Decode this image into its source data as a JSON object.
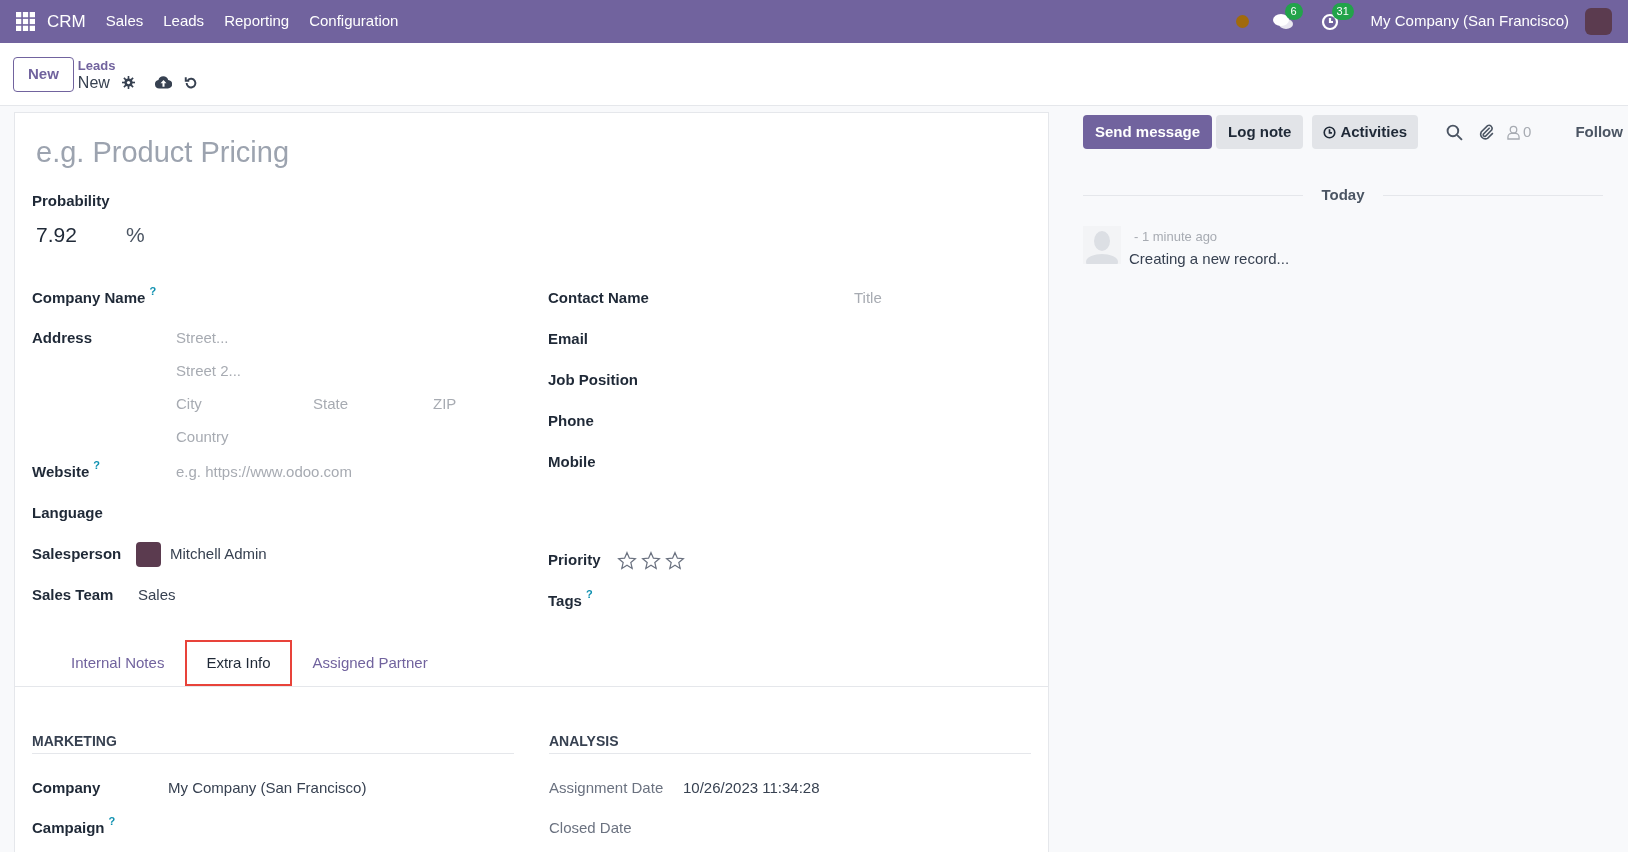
{
  "navbar": {
    "app": "CRM",
    "menu": [
      "Sales",
      "Leads",
      "Reporting",
      "Configuration"
    ],
    "messages_badge": "6",
    "activities_badge": "31",
    "company": "My Company (San Francisco)"
  },
  "control_panel": {
    "new_button": "New",
    "breadcrumb": "Leads",
    "record": "New"
  },
  "form": {
    "title_placeholder": "e.g. Product Pricing",
    "probability": {
      "label": "Probability",
      "value": "7.92",
      "unit": "%"
    },
    "left_fields": [
      {
        "kind": "plain",
        "label": "Company Name",
        "help": "?"
      },
      {
        "kind": "address",
        "label": "Address",
        "street": "Street...",
        "street2": "Street 2...",
        "city": "City",
        "state": "State",
        "zip": "ZIP",
        "country": "Country"
      },
      {
        "kind": "plain",
        "label": "Website",
        "help": "?",
        "placeholder": "e.g. https://www.odoo.com"
      },
      {
        "kind": "plain",
        "label": "Language"
      },
      {
        "kind": "user",
        "label": "Salesperson",
        "value": "Mitchell Admin"
      },
      {
        "kind": "plain",
        "label": "Sales Team",
        "value": "Sales"
      }
    ],
    "right_fields": [
      {
        "kind": "plain",
        "label": "Contact Name",
        "placeholder": "Title"
      },
      {
        "kind": "plain",
        "label": "Email"
      },
      {
        "kind": "plain",
        "label": "Job Position"
      },
      {
        "kind": "plain",
        "label": "Phone"
      },
      {
        "kind": "plain",
        "label": "Mobile"
      },
      {
        "kind": "stars",
        "label": "Priority",
        "stars": 0
      },
      {
        "kind": "plain",
        "label": "Tags",
        "help": "?"
      }
    ],
    "tabs": [
      {
        "label": "Internal Notes",
        "selected": false,
        "highlighted": false
      },
      {
        "label": "Extra Info",
        "selected": true,
        "highlighted": true
      },
      {
        "label": "Assigned Partner",
        "selected": false,
        "highlighted": false
      }
    ],
    "sections": [
      {
        "heading": "MARKETING",
        "fields": [
          {
            "label": "Company",
            "value": "My Company (San Francisco)",
            "muted": false
          },
          {
            "label": "Campaign",
            "help": "?",
            "muted": false
          }
        ]
      },
      {
        "heading": "ANALYSIS",
        "fields": [
          {
            "label": "Assignment Date",
            "value": "10/26/2023 11:34:28",
            "muted": true
          },
          {
            "label": "Closed Date",
            "muted": true
          }
        ]
      }
    ]
  },
  "chatter": {
    "send_message": "Send message",
    "log_note": "Log note",
    "activities": "Activities",
    "followers": "0",
    "follow": "Follow",
    "date_separator": "Today",
    "messages": [
      {
        "time": "- 1 minute ago",
        "body": "Creating a new record..."
      }
    ]
  }
}
